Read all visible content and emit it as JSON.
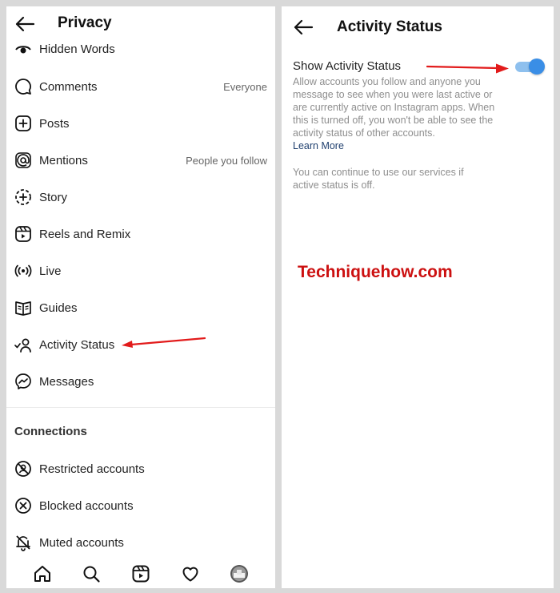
{
  "colors": {
    "accent": "#3a8ee6",
    "toggle_track": "#8ec0ee",
    "link": "#1f3f6e",
    "annotation_red": "#e21b1b",
    "watermark_red": "#cc1010"
  },
  "privacy": {
    "title": "Privacy",
    "items": [
      {
        "label": "Hidden Words",
        "value": "",
        "icon": "eye-icon"
      },
      {
        "label": "Comments",
        "value": "Everyone",
        "icon": "comment-icon"
      },
      {
        "label": "Posts",
        "value": "",
        "icon": "plus-square-icon"
      },
      {
        "label": "Mentions",
        "value": "People you follow",
        "icon": "at-icon"
      },
      {
        "label": "Story",
        "value": "",
        "icon": "story-add-icon"
      },
      {
        "label": "Reels and Remix",
        "value": "",
        "icon": "reels-icon"
      },
      {
        "label": "Live",
        "value": "",
        "icon": "live-icon"
      },
      {
        "label": "Guides",
        "value": "",
        "icon": "guides-icon"
      },
      {
        "label": "Activity Status",
        "value": "",
        "icon": "activity-status-icon"
      },
      {
        "label": "Messages",
        "value": "",
        "icon": "messenger-icon"
      }
    ],
    "connections_header": "Connections",
    "connections": [
      {
        "label": "Restricted accounts",
        "icon": "restricted-icon"
      },
      {
        "label": "Blocked accounts",
        "icon": "blocked-icon"
      },
      {
        "label": "Muted accounts",
        "icon": "muted-icon"
      }
    ],
    "nav": [
      "home-icon",
      "search-icon",
      "reels-nav-icon",
      "heart-icon",
      "profile-avatar"
    ]
  },
  "activity": {
    "title": "Activity Status",
    "setting_label": "Show Activity Status",
    "toggle_on": true,
    "description": "Allow accounts you follow and anyone you message to see when you were last active or are currently active on Instagram apps. When this is turned off, you won't be able to see the activity status of other accounts.",
    "learn_more": "Learn More",
    "note": "You can continue to use our services if active status is off."
  },
  "watermark": "Techniquehow.com"
}
